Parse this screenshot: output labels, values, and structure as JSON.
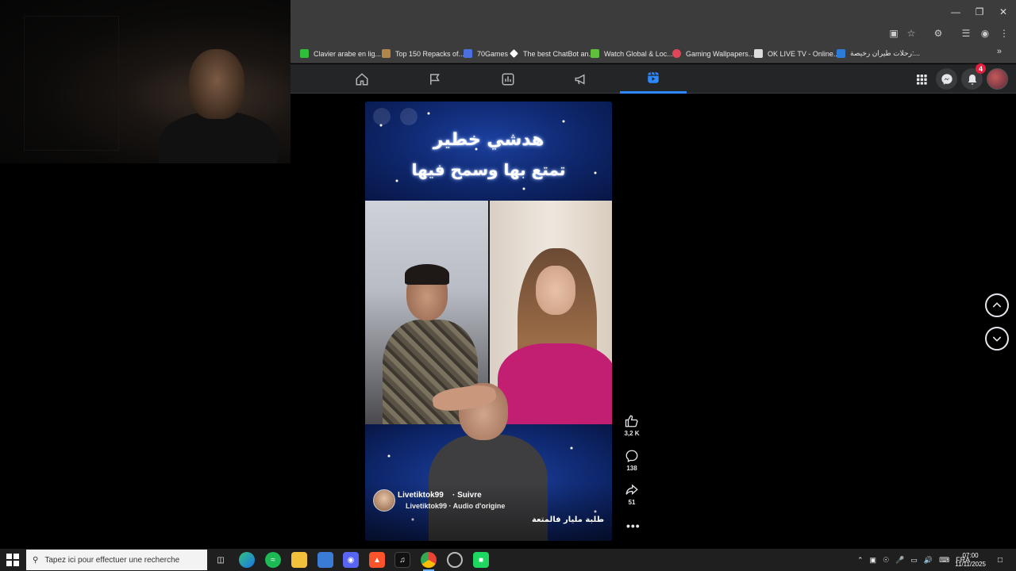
{
  "bookmarks": [
    {
      "label": "Clavier arabe en lig...",
      "color": "#2fbf3a"
    },
    {
      "label": "Top 150 Repacks of...",
      "color": "#b0864a"
    },
    {
      "label": "70Games",
      "color": "#4a6fe0"
    },
    {
      "label": "The best ChatBot an...",
      "color": "#ffffff"
    },
    {
      "label": "Watch Global & Loc...",
      "color": "#5fbf3a"
    },
    {
      "label": "Gaming Wallpapers...",
      "color": "#e0465a"
    },
    {
      "label": "OK LIVE TV - Online...",
      "color": "#dddddd"
    },
    {
      "label": "رحلات طيران رخيصة:...",
      "color": "#2d7bd8"
    }
  ],
  "notifications_count": "4",
  "reel": {
    "title_line1": "هدشي خطير",
    "title_line2": "تمتع بها وسمح فيها",
    "author": "Livetiktok99",
    "follow": "· Suivre",
    "audio": "Livetiktok99 · Audio d'origine",
    "caption": "طلبة مليار فالمتعة"
  },
  "actions": {
    "likes": "3,2 K",
    "comments": "138",
    "shares": "51"
  },
  "taskbar": {
    "search_placeholder": "Tapez ici pour effectuer une recherche",
    "lang": "FRA",
    "time": "07:00",
    "date": "11/11/2025"
  },
  "colors": {
    "accent": "#2d88ff",
    "badge": "#e41e3f",
    "facebook_bg": "#242526"
  }
}
